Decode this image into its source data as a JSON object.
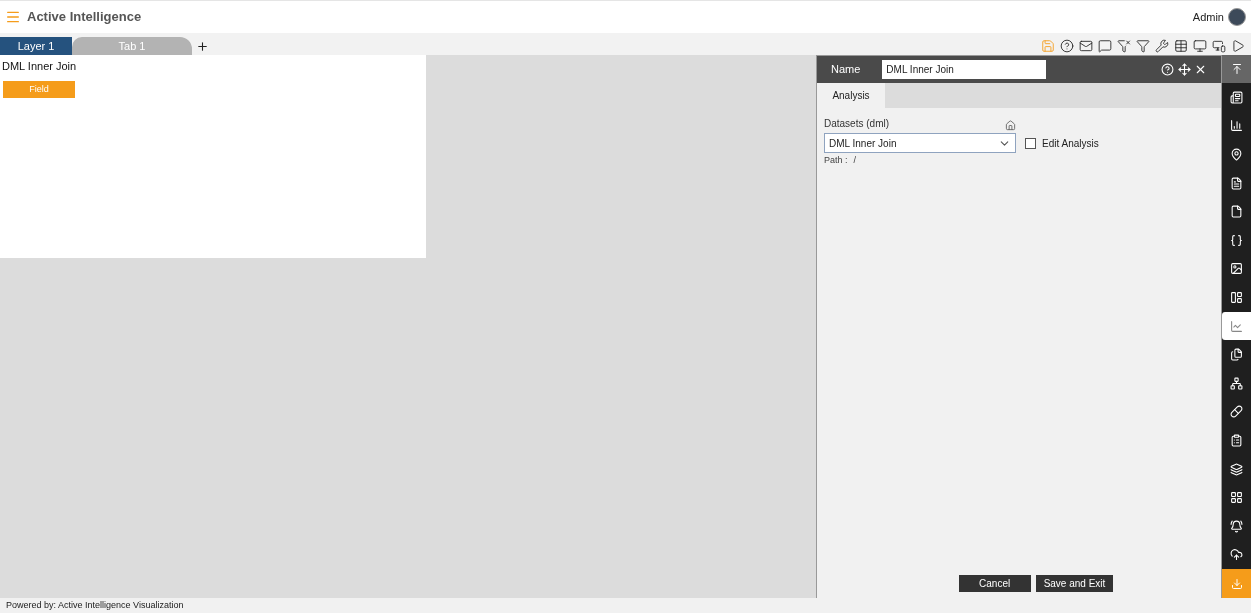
{
  "app": {
    "title": "Active Intelligence",
    "user": "Admin"
  },
  "tabs": [
    {
      "label": "Layer 1",
      "selected": true
    },
    {
      "label": "Tab 1",
      "selected": false
    }
  ],
  "widget": {
    "title": "DML Inner Join",
    "button": "Field"
  },
  "panel": {
    "name_label": "Name",
    "name_value": "DML Inner Join",
    "tabs": [
      {
        "label": "Analysis",
        "selected": true
      }
    ],
    "datasets_label": "Datasets (dml)",
    "dataset_value": "DML Inner Join",
    "edit_analysis": {
      "label": "Edit Analysis",
      "checked": false
    },
    "path_label": "Path :",
    "path_value": "/",
    "buttons": [
      "Cancel",
      "Save and Exit"
    ]
  },
  "sidebar": {
    "items": [
      {
        "selected": false
      },
      {
        "selected": false
      },
      {
        "selected": false
      },
      {
        "selected": false
      },
      {
        "selected": false
      },
      {
        "selected": false
      },
      {
        "selected": false
      },
      {
        "selected": false
      },
      {
        "selected": true
      },
      {
        "selected": false
      },
      {
        "selected": false
      },
      {
        "selected": false
      },
      {
        "selected": false
      },
      {
        "selected": false
      },
      {
        "selected": false
      },
      {
        "selected": false
      },
      {
        "selected": false
      }
    ]
  },
  "footer": "Powered by: Active Intelligence Visualization"
}
